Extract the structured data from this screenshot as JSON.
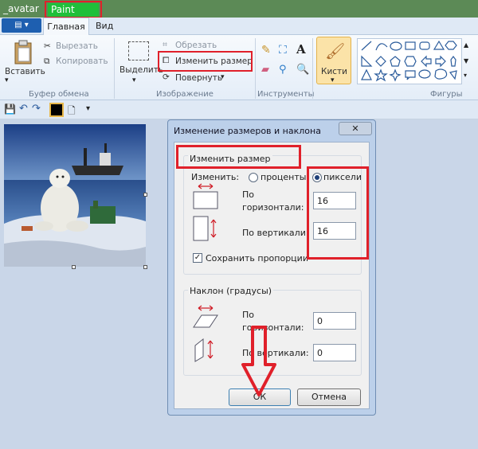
{
  "titlebar": {
    "left_text": "_avatar",
    "app_name": "Paint"
  },
  "tabs": {
    "home": "Главная",
    "view": "Вид"
  },
  "ribbon": {
    "paste": "Вставить",
    "cut": "Вырезать",
    "copy": "Копировать",
    "clipboard_group": "Буфер обмена",
    "select": "Выделить",
    "crop": "Обрезать",
    "resize": "Изменить размер",
    "rotate": "Повернуть",
    "image_group": "Изображение",
    "tools_group": "Инструменты",
    "brushes": "Кисти",
    "shapes_group": "Фигуры"
  },
  "dialog": {
    "title": "Изменение размеров и наклона",
    "close": "✕",
    "resize_section": "Изменить размер",
    "change_by": "Изменить:",
    "percent": "проценты",
    "pixels": "пиксели",
    "horizontal": "По горизонтали:",
    "vertical": "По вертикали:",
    "resize_h_value": "16",
    "resize_v_value": "16",
    "keep_ratio": "Сохранить пропорции",
    "skew_section": "Наклон (градусы)",
    "skew_h_value": "0",
    "skew_v_value": "0",
    "ok": "ОК",
    "cancel": "Отмена"
  },
  "colors": {
    "highlight": "#e0202a",
    "title_green": "#1fbf3a",
    "file_blue": "#1e5fb0"
  }
}
